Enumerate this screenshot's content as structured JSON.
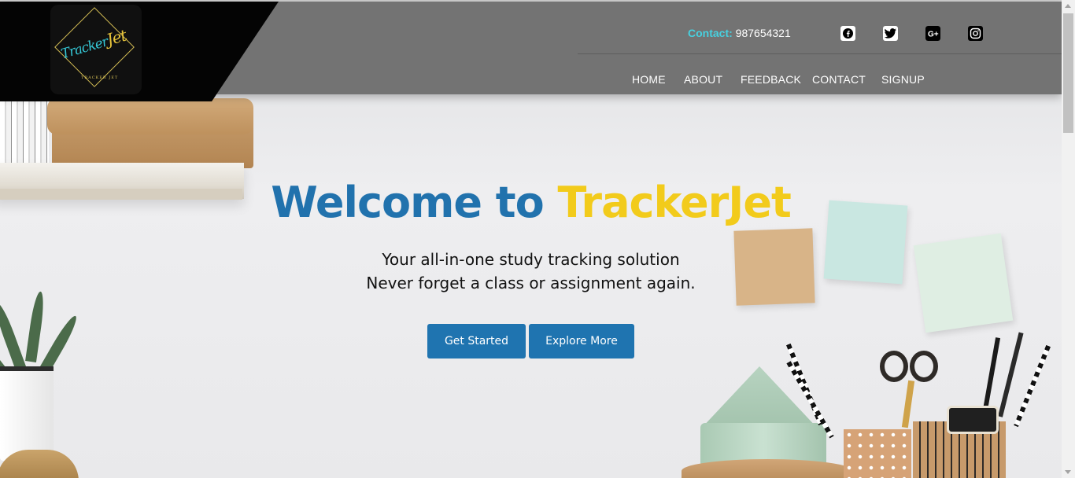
{
  "brand": {
    "logo_script_left": "Tracker",
    "logo_script_right": "Jet",
    "logo_subtitle": "TRACKER JET"
  },
  "header": {
    "contact_label": "Contact:",
    "contact_number": "987654321",
    "social_icons": [
      "facebook-icon",
      "twitter-icon",
      "google-plus-icon",
      "instagram-icon"
    ],
    "nav": [
      "HOME",
      "ABOUT",
      "FEEDBACK",
      "CONTACT",
      "SIGNUP"
    ]
  },
  "hero": {
    "title_part1": "Welcome to ",
    "title_part2": "TrackerJet",
    "line1": "Your all-in-one study tracking solution",
    "line2": "Never forget a class or assignment again.",
    "primary_button": "Get Started",
    "secondary_button": "Explore More"
  },
  "colors": {
    "header_bg": "#737373",
    "accent_blue": "#2172ad",
    "accent_yellow": "#f2cb1b",
    "contact_label": "#47d1e0",
    "button_bg": "#1f74b0"
  }
}
